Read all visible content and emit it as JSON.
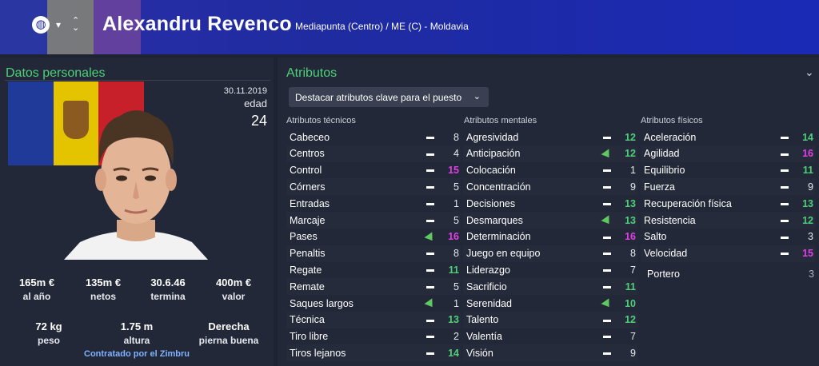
{
  "header": {
    "name": "Alexandru Revenco",
    "subtitle": "Mediapunta (Centro) / ME (C) - Moldavia"
  },
  "left": {
    "title": "Datos personales",
    "dob": "30.11.2019",
    "age_label": "edad",
    "age": "24",
    "stats_row1": [
      {
        "value": "165m €",
        "label": "al año"
      },
      {
        "value": "135m €",
        "label": "netos"
      },
      {
        "value": "30.6.46",
        "label": "termina"
      },
      {
        "value": "400m €",
        "label": "valor"
      }
    ],
    "stats_row2": [
      {
        "value": "72 kg",
        "label": "peso"
      },
      {
        "value": "1.75 m",
        "label": "altura"
      },
      {
        "value": "Derecha",
        "label": "pierna buena"
      }
    ],
    "contract": "Contratado por el Zimbru"
  },
  "right": {
    "title": "Atributos",
    "dropdown": "Destacar atributos clave para el puesto",
    "columns": [
      {
        "header": "Atributos técnicos",
        "rows": [
          {
            "name": "Cabeceo",
            "ind": "dash",
            "value": "8",
            "color": "plain"
          },
          {
            "name": "Centros",
            "ind": "dash",
            "value": "4",
            "color": "plain"
          },
          {
            "name": "Control",
            "ind": "dash",
            "value": "15",
            "color": "pink"
          },
          {
            "name": "Córners",
            "ind": "dash",
            "value": "5",
            "color": "plain"
          },
          {
            "name": "Entradas",
            "ind": "dash",
            "value": "1",
            "color": "plain"
          },
          {
            "name": "Marcaje",
            "ind": "dash",
            "value": "5",
            "color": "plain"
          },
          {
            "name": "Pases",
            "ind": "arrow",
            "value": "16",
            "color": "pink"
          },
          {
            "name": "Penaltis",
            "ind": "dash",
            "value": "8",
            "color": "plain"
          },
          {
            "name": "Regate",
            "ind": "dash",
            "value": "11",
            "color": "green"
          },
          {
            "name": "Remate",
            "ind": "dash",
            "value": "5",
            "color": "plain"
          },
          {
            "name": "Saques largos",
            "ind": "arrow",
            "value": "1",
            "color": "plain"
          },
          {
            "name": "Técnica",
            "ind": "dash",
            "value": "13",
            "color": "green"
          },
          {
            "name": "Tiro libre",
            "ind": "dash",
            "value": "2",
            "color": "plain"
          },
          {
            "name": "Tiros lejanos",
            "ind": "dash",
            "value": "14",
            "color": "green"
          }
        ]
      },
      {
        "header": "Atributos mentales",
        "rows": [
          {
            "name": "Agresividad",
            "ind": "dash",
            "value": "12",
            "color": "green"
          },
          {
            "name": "Anticipación",
            "ind": "arrow",
            "value": "12",
            "color": "green"
          },
          {
            "name": "Colocación",
            "ind": "dash",
            "value": "1",
            "color": "plain"
          },
          {
            "name": "Concentración",
            "ind": "dash",
            "value": "9",
            "color": "plain"
          },
          {
            "name": "Decisiones",
            "ind": "dash",
            "value": "13",
            "color": "green"
          },
          {
            "name": "Desmarques",
            "ind": "arrow",
            "value": "13",
            "color": "green"
          },
          {
            "name": "Determinación",
            "ind": "dash",
            "value": "16",
            "color": "pink"
          },
          {
            "name": "Juego en equipo",
            "ind": "dash",
            "value": "8",
            "color": "plain"
          },
          {
            "name": "Liderazgo",
            "ind": "dash",
            "value": "7",
            "color": "plain"
          },
          {
            "name": "Sacrificio",
            "ind": "dash",
            "value": "11",
            "color": "green"
          },
          {
            "name": "Serenidad",
            "ind": "arrow",
            "value": "10",
            "color": "green"
          },
          {
            "name": "Talento",
            "ind": "dash",
            "value": "12",
            "color": "green"
          },
          {
            "name": "Valentía",
            "ind": "dash",
            "value": "7",
            "color": "plain"
          },
          {
            "name": "Visión",
            "ind": "dash",
            "value": "9",
            "color": "plain"
          }
        ]
      },
      {
        "header": "Atributos físicos",
        "rows": [
          {
            "name": "Aceleración",
            "ind": "dash",
            "value": "14",
            "color": "green"
          },
          {
            "name": "Agilidad",
            "ind": "dash",
            "value": "16",
            "color": "pink"
          },
          {
            "name": "Equilibrio",
            "ind": "dash",
            "value": "11",
            "color": "green"
          },
          {
            "name": "Fuerza",
            "ind": "dash",
            "value": "9",
            "color": "plain"
          },
          {
            "name": "Recuperación física",
            "ind": "dash",
            "value": "13",
            "color": "green"
          },
          {
            "name": "Resistencia",
            "ind": "dash",
            "value": "12",
            "color": "green"
          },
          {
            "name": "Salto",
            "ind": "dash",
            "value": "3",
            "color": "plain"
          },
          {
            "name": "Velocidad",
            "ind": "dash",
            "value": "15",
            "color": "pink"
          }
        ]
      }
    ],
    "extra": {
      "name": "Portero",
      "value": "3"
    }
  }
}
